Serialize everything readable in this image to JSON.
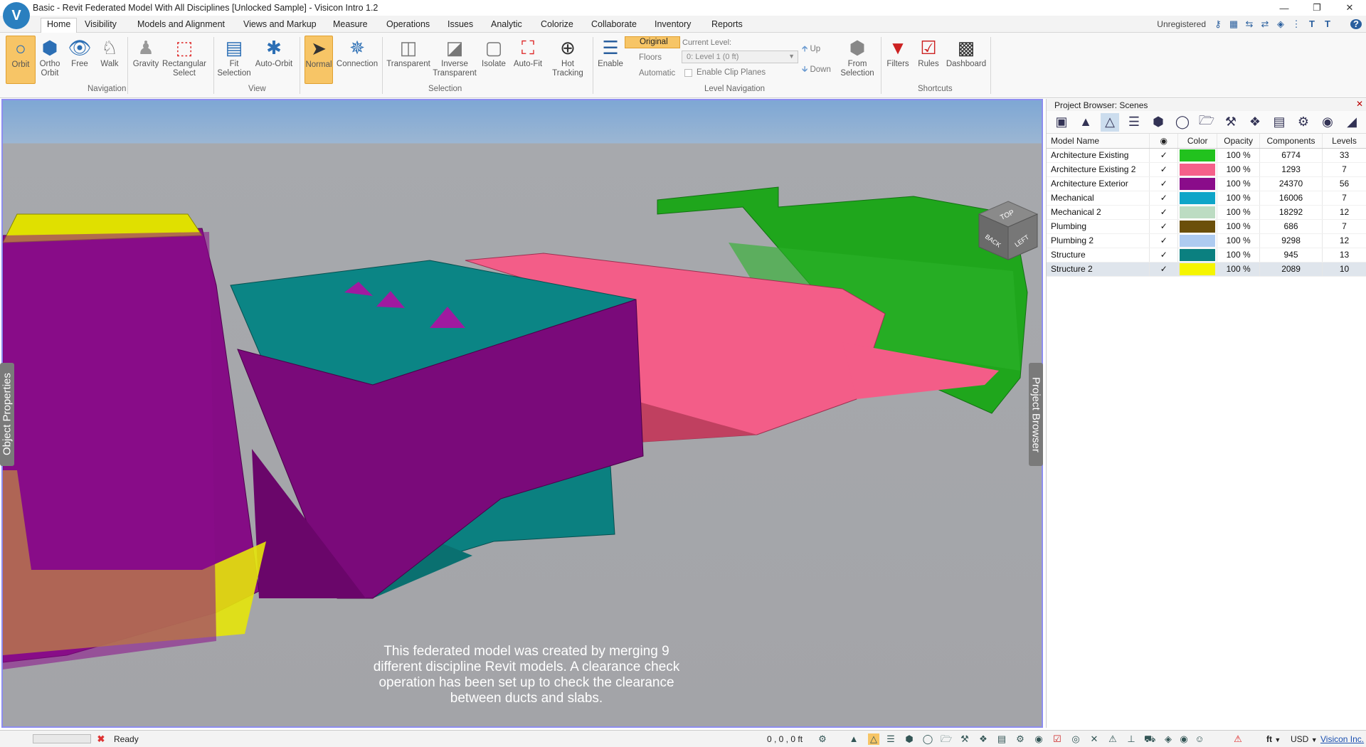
{
  "window": {
    "title": "Basic - Revit Federated Model With All Disciplines [Unlocked Sample] - Visicon Intro 1.2"
  },
  "menu": {
    "tabs": [
      "Home",
      "Visibility",
      "Models and Alignment",
      "Views and Markup",
      "Measure",
      "Operations",
      "Issues",
      "Analytic",
      "Colorize",
      "Collaborate",
      "Inventory",
      "Reports"
    ],
    "license": "Unregistered"
  },
  "ribbon": {
    "navigation": {
      "group": "Navigation",
      "orbit": "Orbit",
      "ortho_orbit": "Ortho\nOrbit",
      "free": "Free",
      "walk": "Walk",
      "gravity": "Gravity",
      "rect_select": "Rectangular\nSelect"
    },
    "view": {
      "group": "View",
      "fit_selection": "Fit\nSelection",
      "auto_orbit": "Auto-Orbit"
    },
    "selection": {
      "group": "Selection",
      "normal": "Normal",
      "connection": "Connection",
      "transparent": "Transparent",
      "inverse_transparent": "Inverse\nTransparent",
      "isolate": "Isolate",
      "auto_fit": "Auto-Fit",
      "hot_tracking": "Hot\nTracking"
    },
    "level": {
      "group": "Level Navigation",
      "enable": "Enable",
      "original": "Original",
      "floors": "Floors",
      "automatic": "Automatic",
      "current_level_label": "Current Level:",
      "current_level_value": "0: Level 1 (0 ft)",
      "enable_clip": "Enable Clip Planes",
      "up": "Up",
      "down": "Down",
      "from_selection": "From\nSelection"
    },
    "shortcuts": {
      "group": "Shortcuts",
      "filters": "Filters",
      "rules": "Rules",
      "dashboard": "Dashboard"
    }
  },
  "viewport": {
    "caption": "This federated model was created by merging 9 different discipline Revit models. A clearance check operation has been set up to check the clearance between ducts and slabs.",
    "cube": {
      "top": "TOP",
      "left": "LEFT",
      "back": "BACK"
    },
    "left_tab": "Object Properties",
    "right_tab": "Project Browser"
  },
  "browser": {
    "title": "Project Browser: Scenes",
    "columns": [
      "Model Name",
      "◉",
      "Color",
      "Opacity",
      "Components",
      "Levels"
    ],
    "rows": [
      {
        "name": "Architecture Existing",
        "visible": "✓",
        "color": "#22c21e",
        "opacity": "100 %",
        "components": "6774",
        "levels": "33"
      },
      {
        "name": "Architecture Existing 2",
        "visible": "✓",
        "color": "#f5608a",
        "opacity": "100 %",
        "components": "1293",
        "levels": "7"
      },
      {
        "name": "Architecture Exterior",
        "visible": "✓",
        "color": "#8a0c8a",
        "opacity": "100 %",
        "components": "24370",
        "levels": "56"
      },
      {
        "name": "Mechanical",
        "visible": "✓",
        "color": "#0fa5c8",
        "opacity": "100 %",
        "components": "16006",
        "levels": "7"
      },
      {
        "name": "Mechanical 2",
        "visible": "✓",
        "color": "#bcdcc2",
        "opacity": "100 %",
        "components": "18292",
        "levels": "12"
      },
      {
        "name": "Plumbing",
        "visible": "✓",
        "color": "#6b4f0a",
        "opacity": "100 %",
        "components": "686",
        "levels": "7"
      },
      {
        "name": "Plumbing 2",
        "visible": "✓",
        "color": "#aecbf0",
        "opacity": "100 %",
        "components": "9298",
        "levels": "12"
      },
      {
        "name": "Structure",
        "visible": "✓",
        "color": "#0b8080",
        "opacity": "100 %",
        "components": "945",
        "levels": "13"
      },
      {
        "name": "Structure 2",
        "visible": "✓",
        "color": "#f5f500",
        "opacity": "100 %",
        "components": "2089",
        "levels": "10"
      }
    ]
  },
  "status": {
    "text": "Ready",
    "coords": "0 , 0 , 0 ft",
    "unit": "ft",
    "currency": "USD",
    "company": "Visicon Inc."
  }
}
